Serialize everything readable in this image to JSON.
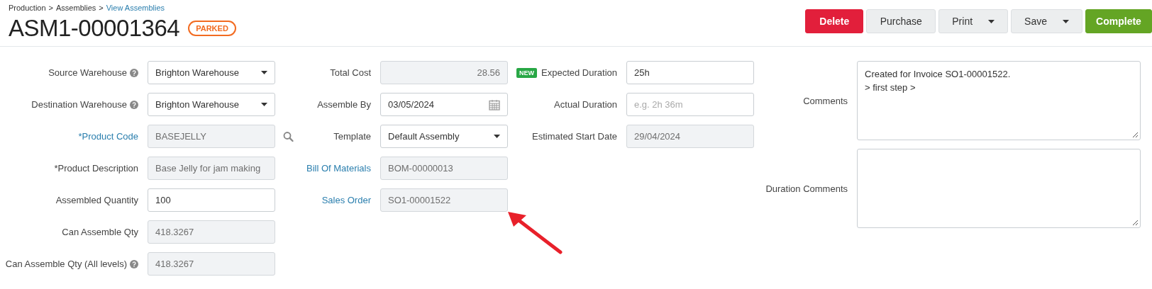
{
  "breadcrumb": [
    {
      "label": "Production",
      "link": false
    },
    {
      "label": "Assemblies",
      "link": false
    },
    {
      "label": "View Assemblies",
      "link": true
    }
  ],
  "breadcrumb_separator": ">",
  "title": "ASM1-00001364",
  "status_badge": "PARKED",
  "buttons": [
    {
      "label": "Delete",
      "kind": "danger",
      "dropdown": false
    },
    {
      "label": "Purchase",
      "kind": "default",
      "dropdown": false
    },
    {
      "label": "Print",
      "kind": "default",
      "dropdown": true
    },
    {
      "label": "Save",
      "kind": "default",
      "dropdown": true
    },
    {
      "label": "Complete",
      "kind": "success",
      "dropdown": false
    }
  ],
  "columns": [
    {
      "fields": [
        {
          "label": "Source Warehouse",
          "link": false,
          "help": true,
          "kind": "select",
          "value": "Brighton Warehouse",
          "disabled": false
        },
        {
          "label": "Destination Warehouse",
          "link": false,
          "help": true,
          "kind": "select",
          "value": "Brighton Warehouse",
          "disabled": false
        },
        {
          "label": "*Product Code",
          "link": true,
          "help": false,
          "kind": "search",
          "value": "BASEJELLY",
          "disabled": true
        },
        {
          "label": "*Product Description",
          "link": false,
          "help": false,
          "kind": "input",
          "value": "Base Jelly for jam making",
          "disabled": true
        },
        {
          "label": "Assembled Quantity",
          "link": false,
          "help": false,
          "kind": "input",
          "value": "100",
          "disabled": false
        },
        {
          "label": "Can Assemble Qty",
          "link": false,
          "help": false,
          "kind": "input",
          "value": "418.3267",
          "disabled": true
        },
        {
          "label": "Can Assemble Qty (All levels)",
          "link": false,
          "help": true,
          "kind": "input",
          "value": "418.3267",
          "disabled": true
        }
      ]
    },
    {
      "fields": [
        {
          "label": "Total Cost",
          "link": false,
          "help": false,
          "kind": "number",
          "value": "28.56",
          "disabled": true
        },
        {
          "label": "Assemble By",
          "link": false,
          "help": false,
          "kind": "date",
          "value": "03/05/2024",
          "disabled": false
        },
        {
          "label": "Template",
          "link": false,
          "help": false,
          "kind": "select",
          "value": "Default Assembly",
          "disabled": false
        },
        {
          "label": "Bill Of Materials",
          "link": true,
          "help": false,
          "kind": "input",
          "value": "BOM-00000013",
          "disabled": true
        },
        {
          "label": "Sales Order",
          "link": true,
          "help": false,
          "kind": "input",
          "value": "SO1-00001522",
          "disabled": true
        }
      ]
    },
    {
      "fields": [
        {
          "label": "Expected Duration",
          "badge": "NEW",
          "link": false,
          "help": false,
          "kind": "input",
          "value": "25h",
          "disabled": false
        },
        {
          "label": "Actual Duration",
          "link": false,
          "help": false,
          "kind": "input",
          "placeholder": "e.g. 2h 36m",
          "disabled": false
        },
        {
          "label": "Estimated Start Date",
          "link": false,
          "help": false,
          "kind": "input",
          "value": "29/04/2024",
          "disabled": true
        }
      ]
    },
    {
      "fields": [
        {
          "label": "Comments",
          "link": false,
          "help": false,
          "kind": "textarea",
          "lines": [
            "Created for Invoice SO1-00001522.",
            "> first step >"
          ],
          "disabled": false
        },
        {
          "label": "Duration Comments",
          "link": false,
          "help": false,
          "kind": "textarea",
          "disabled": false
        }
      ]
    }
  ]
}
